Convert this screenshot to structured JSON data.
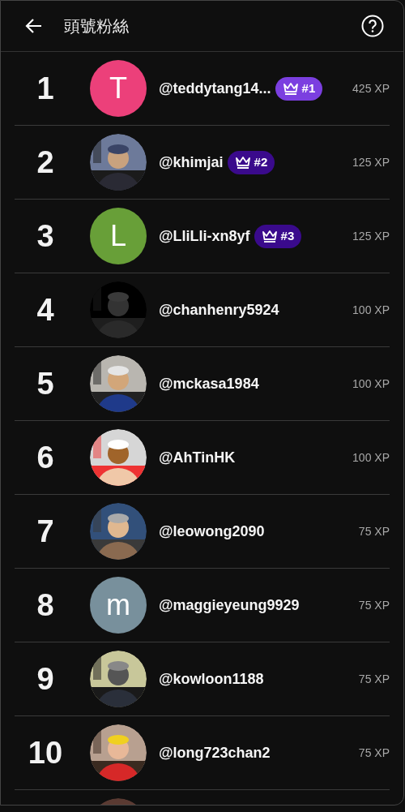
{
  "header": {
    "title": "頭號粉絲"
  },
  "rows": [
    {
      "rank": "1",
      "avatar": {
        "kind": "letter",
        "letter": "T",
        "color": "#ec407a"
      },
      "name": "@teddytang14...",
      "badge": {
        "label": "#1",
        "color": "#7b3fe0"
      },
      "xp": "425 XP"
    },
    {
      "rank": "2",
      "avatar": {
        "kind": "picture"
      },
      "name": "@khimjai",
      "badge": {
        "label": "#2",
        "color": "#3a0a8c"
      },
      "xp": "125 XP"
    },
    {
      "rank": "3",
      "avatar": {
        "kind": "letter",
        "letter": "L",
        "color": "#689f38"
      },
      "name": "@LliLli-xn8yf",
      "badge": {
        "label": "#3",
        "color": "#3a0a8c"
      },
      "xp": "125 XP"
    },
    {
      "rank": "4",
      "avatar": {
        "kind": "picture"
      },
      "name": "@chanhenry5924",
      "xp": "100 XP"
    },
    {
      "rank": "5",
      "avatar": {
        "kind": "picture"
      },
      "name": "@mckasa1984",
      "xp": "100 XP"
    },
    {
      "rank": "6",
      "avatar": {
        "kind": "picture"
      },
      "name": "@AhTinHK",
      "xp": "100 XP"
    },
    {
      "rank": "7",
      "avatar": {
        "kind": "picture"
      },
      "name": "@leowong2090",
      "xp": "75 XP"
    },
    {
      "rank": "8",
      "avatar": {
        "kind": "letter",
        "letter": "m",
        "color": "#78909c"
      },
      "name": "@maggieyeung9929",
      "xp": "75 XP"
    },
    {
      "rank": "9",
      "avatar": {
        "kind": "picture"
      },
      "name": "@kowloon1188",
      "xp": "75 XP"
    },
    {
      "rank": "10",
      "avatar": {
        "kind": "picture"
      },
      "name": "@long723chan2",
      "xp": "75 XP"
    },
    {
      "avatar": {
        "kind": "picture"
      }
    }
  ]
}
